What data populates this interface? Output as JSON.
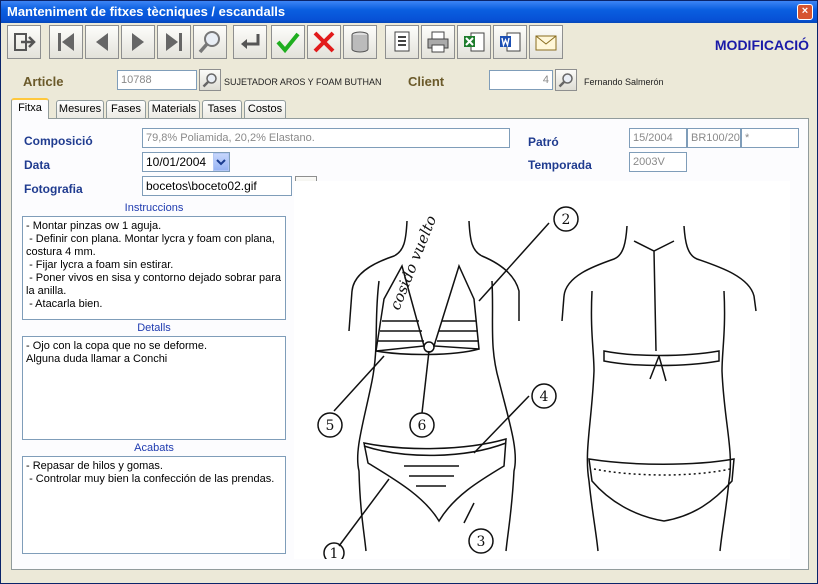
{
  "window": {
    "title": "Manteniment de fitxes tècniques / escandalls",
    "close_glyph": "×"
  },
  "toolbar": {
    "mode": "MODIFICACIÓ",
    "buttons": [
      "exit",
      "first",
      "previous",
      "next",
      "last",
      "search",
      "return",
      "accept",
      "cancel",
      "database",
      "report",
      "print",
      "excel",
      "word",
      "email"
    ]
  },
  "header": {
    "article_label": "Article",
    "article_code": "10788",
    "article_desc": "SUJETADOR AROS Y FOAM BUTHAN",
    "client_label": "Client",
    "client_code": "4",
    "client_name": "Fernando Salmerón"
  },
  "tabs": [
    {
      "label": "Fitxa",
      "active": true
    },
    {
      "label": "Mesures",
      "active": false
    },
    {
      "label": "Fases",
      "active": false
    },
    {
      "label": "Materials",
      "active": false
    },
    {
      "label": "Tases",
      "active": false
    },
    {
      "label": "Costos",
      "active": false
    }
  ],
  "fitxa": {
    "composicio_label": "Composició",
    "composicio_value": "79,8% Poliamida, 20,2% Elastano.",
    "data_label": "Data",
    "data_value": "10/01/2004",
    "fotografia_label": "Fotografia",
    "fotografia_value": "bocetos\\boceto02.gif",
    "patro_label": "Patró",
    "patro_value1": "15/2004",
    "patro_value2": "BR100/20",
    "patro_value3": "*",
    "temporada_label": "Temporada",
    "temporada_value": "2003V",
    "instruccions_label": "Instruccions",
    "instruccions_text": "- Montar pinzas ow 1 aguja.\n - Definir con plana. Montar lycra y foam con plana, costura 4 mm.\n - Fijar lycra a foam sin estirar.\n - Poner vivos en sisa y contorno dejado sobrar para la anilla.\n - Atacarla bien.",
    "detalls_label": "Detalls",
    "detalls_text": "- Ojo con la copa que no se deforme.\nAlguna duda llamar a Conchi",
    "acabats_label": "Acabats",
    "acabats_text": "- Repasar de hilos y gomas.\n - Controlar muy bien la confección de las prendas."
  },
  "sketch": {
    "handwritten_note": "cosido vuelto",
    "callouts": [
      "1",
      "2",
      "3",
      "4",
      "5",
      "6"
    ]
  }
}
